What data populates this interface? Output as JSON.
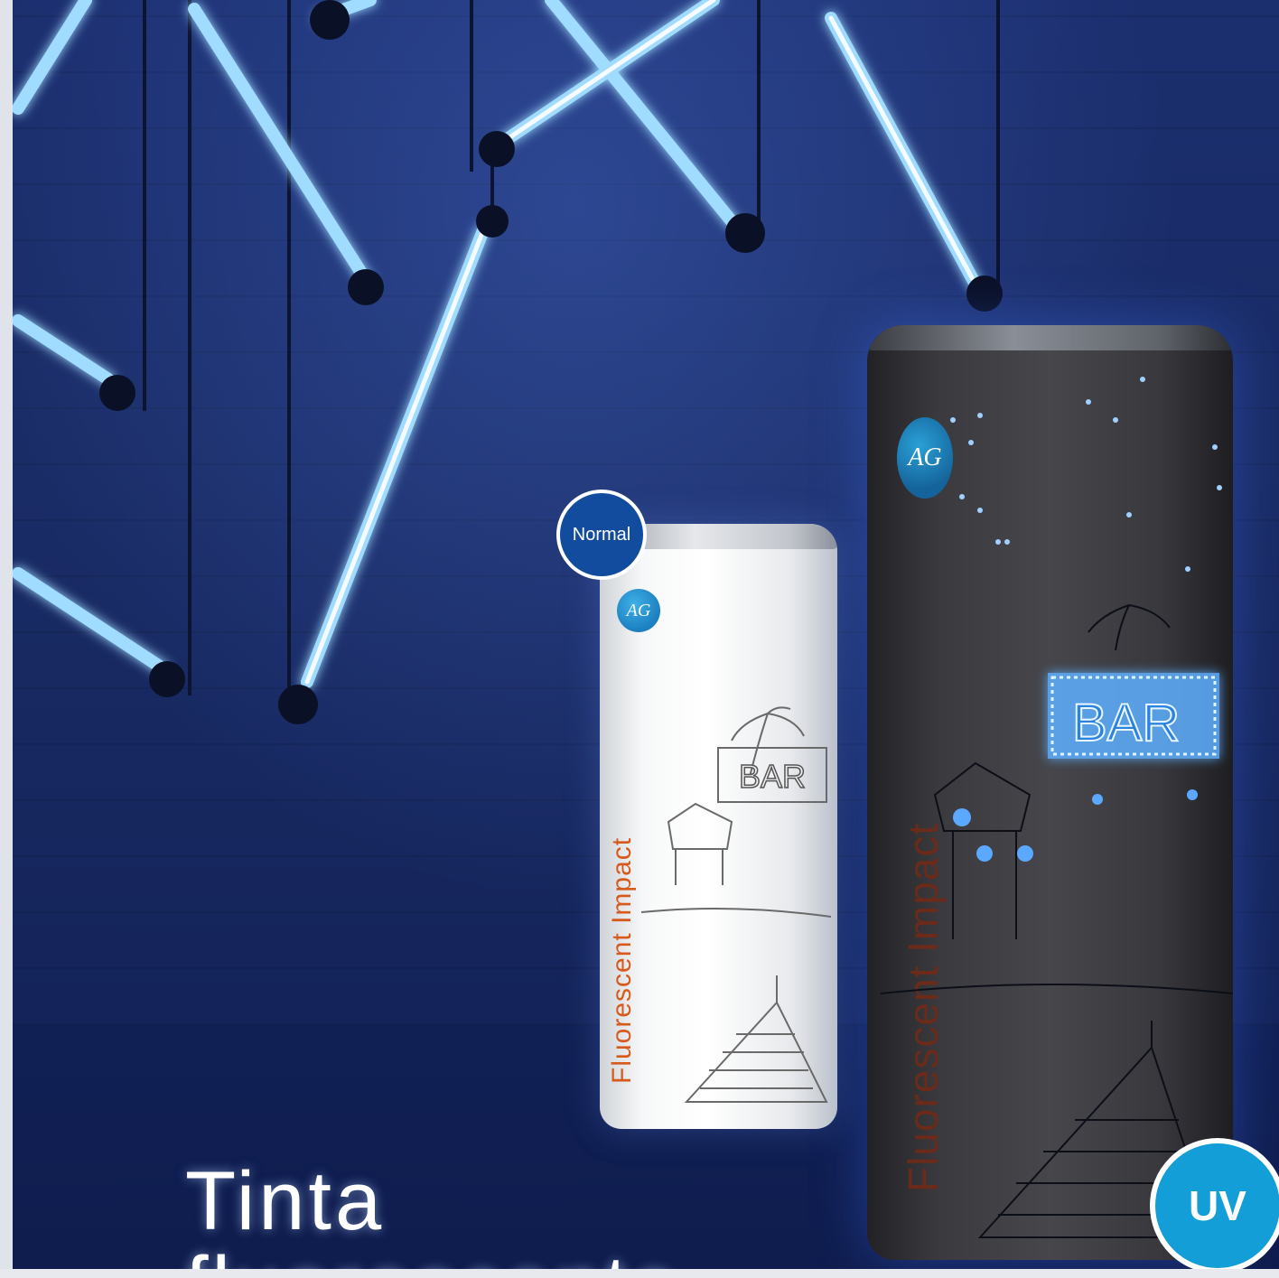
{
  "badges": {
    "normal": "Normal",
    "uv": "UV"
  },
  "can_normal": {
    "brand_text": "Fluorescent Impact",
    "sign_text": "BAR",
    "logo_text": "AG"
  },
  "can_uv": {
    "brand_text": "Fluorescent Impact",
    "sign_text": "BAR",
    "logo_text": "AG"
  },
  "headline": {
    "line1": "Tinta",
    "line2": "fluorescente"
  },
  "colors": {
    "background": "#14245a",
    "neon": "#8fd8ff",
    "badge_normal": "#124c9e",
    "badge_uv": "#149ed8",
    "brand_text": "#d65a1c"
  }
}
